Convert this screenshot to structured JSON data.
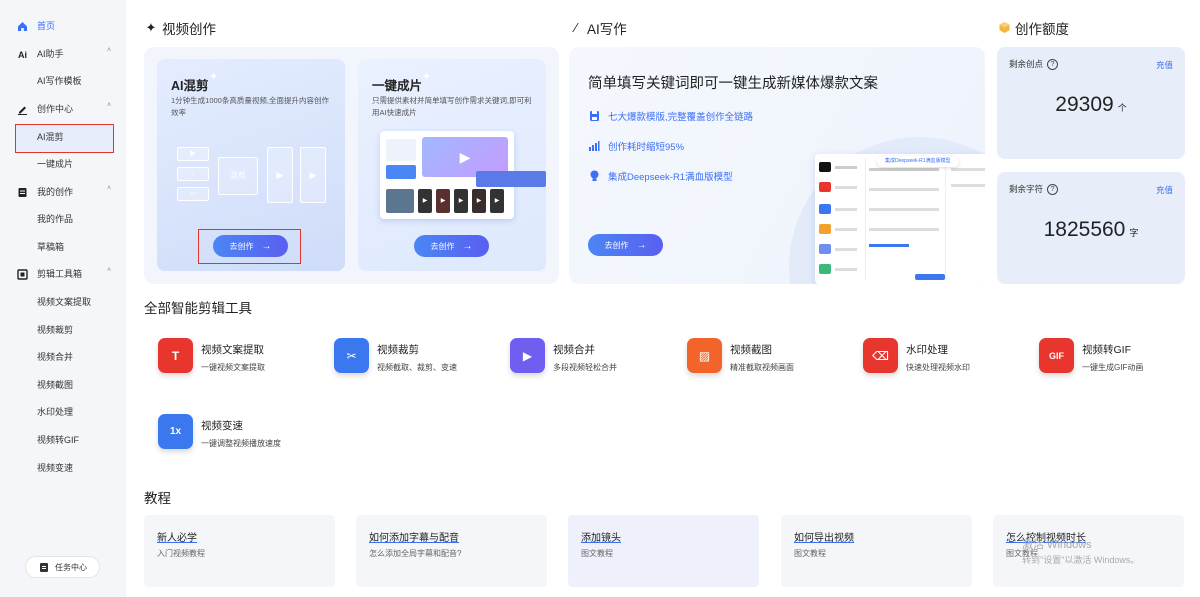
{
  "sidebar": {
    "items": [
      {
        "label": "首页",
        "icon": "home-icon",
        "active": true
      },
      {
        "label": "AI助手",
        "icon": "ai-icon",
        "caret": "˄"
      },
      {
        "label": "AI写作模板"
      },
      {
        "label": "创作中心",
        "icon": "pen-icon",
        "caret": "˄"
      },
      {
        "label": "AI混剪"
      },
      {
        "label": "一键成片"
      },
      {
        "label": "我的创作",
        "icon": "document-icon",
        "caret": "˄"
      },
      {
        "label": "我的作品"
      },
      {
        "label": "草稿箱"
      },
      {
        "label": "剪辑工具箱",
        "icon": "toolbox-icon",
        "caret": "˄"
      },
      {
        "label": "视频文案提取"
      },
      {
        "label": "视频裁剪"
      },
      {
        "label": "视频合并"
      },
      {
        "label": "视频截图"
      },
      {
        "label": "水印处理"
      },
      {
        "label": "视频转GIF"
      },
      {
        "label": "视频变速"
      }
    ],
    "task_center": "任务中心"
  },
  "video_creation": {
    "heading": "视频创作",
    "cards": [
      {
        "title": "AI混剪",
        "desc": "1分钟生成1000条高质量视频,全面提升内容创作效率",
        "button": "去创作",
        "mix_label": "混剪"
      },
      {
        "title": "一键成片",
        "desc": "只需提供素材并简单填写创作需求关键词,即可利用AI快速成片",
        "button": "去创作"
      }
    ]
  },
  "ai_writing": {
    "heading": "AI写作",
    "title": "简单填写关键词即可一键生成新媒体爆款文案",
    "features": [
      "七大爆款模版,完整覆盖创作全链路",
      "创作耗时缩短95%",
      "集成Deepseek-R1满血版模型"
    ],
    "button": "去创作",
    "mock_tag": "集成Deepseek-R1满血版模型"
  },
  "quota": {
    "heading": "创作额度",
    "items": [
      {
        "label": "剩余创点",
        "action": "充值",
        "value": "29309",
        "unit": "个"
      },
      {
        "label": "剩余字符",
        "action": "充值",
        "value": "1825560",
        "unit": "字"
      }
    ]
  },
  "tools": {
    "heading": "全部智能剪辑工具",
    "items": [
      {
        "title": "视频文案提取",
        "desc": "一键视频文案提取",
        "color": "#e8362f",
        "icon": "text-extract-icon",
        "glyph": "T"
      },
      {
        "title": "视频裁剪",
        "desc": "视频截取、裁剪、变速",
        "color": "#3b78f0",
        "icon": "scissors-icon",
        "glyph": "✂"
      },
      {
        "title": "视频合并",
        "desc": "多段视频轻松合并",
        "color": "#6f5ef0",
        "icon": "merge-icon",
        "glyph": "▶"
      },
      {
        "title": "视频截图",
        "desc": "精准截取视频画面",
        "color": "#f2642a",
        "icon": "screenshot-icon",
        "glyph": "▨"
      },
      {
        "title": "水印处理",
        "desc": "快速处理视频水印",
        "color": "#e8362f",
        "icon": "eraser-icon",
        "glyph": "⌫"
      },
      {
        "title": "视频转GIF",
        "desc": "一键生成GIF动画",
        "color": "#e8362f",
        "icon": "gif-icon",
        "glyph": "GIF"
      },
      {
        "title": "视频变速",
        "desc": "一键调整视频播放速度",
        "color": "#3b78f0",
        "icon": "speed-icon",
        "glyph": "1x"
      }
    ]
  },
  "tutorials": {
    "heading": "教程",
    "items": [
      {
        "title": "新人必学",
        "desc": "入门视频教程"
      },
      {
        "title": "如何添加字幕与配音",
        "desc": "怎么添加全局字幕和配音?"
      },
      {
        "title": "添加镜头",
        "desc": "图文教程"
      },
      {
        "title": "如何导出视频",
        "desc": "图文教程"
      },
      {
        "title": "怎么控制视频时长",
        "desc": "图文教程"
      }
    ]
  },
  "watermark": {
    "line1": "激活 Windows",
    "line2": "转到\"设置\"以激活 Windows。"
  }
}
